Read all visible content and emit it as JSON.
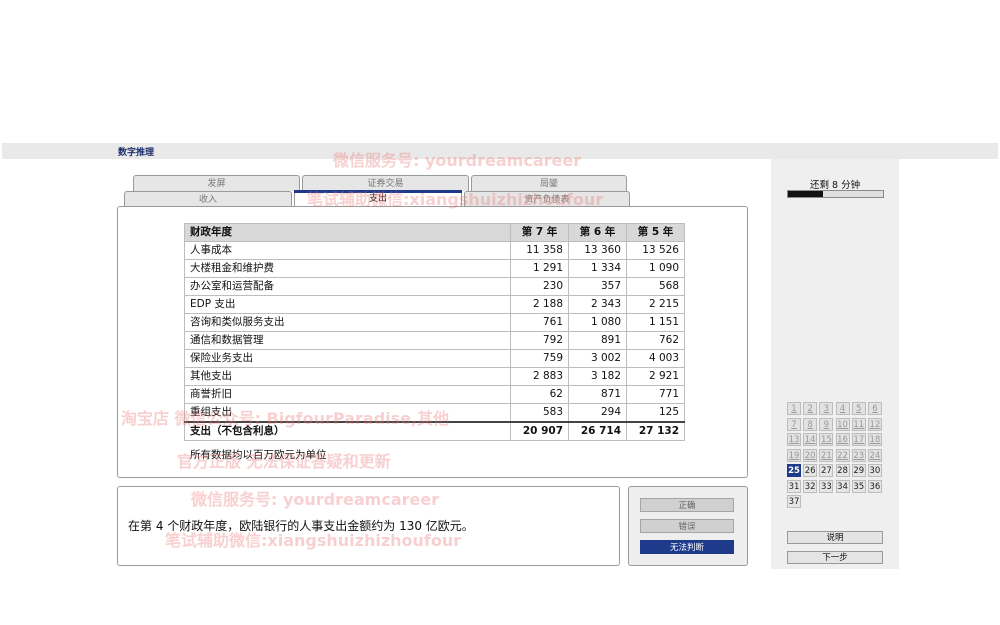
{
  "app": {
    "title": "数字推理"
  },
  "tabs_back": [
    "发屏",
    "证券交易",
    "局鑾"
  ],
  "tabs_front": [
    "收入",
    "支出",
    "资产负债表"
  ],
  "active_tab": "支出",
  "table": {
    "headers": [
      "财政年度",
      "第 7 年",
      "第 6 年",
      "第 5 年"
    ],
    "rows": [
      [
        "人事成本",
        "11 358",
        "13 360",
        "13 526"
      ],
      [
        "大楼租金和维护费",
        "1 291",
        "1 334",
        "1 090"
      ],
      [
        "办公室和运营配备",
        "230",
        "357",
        "568"
      ],
      [
        "EDP 支出",
        "2 188",
        "2 343",
        "2 215"
      ],
      [
        "咨询和类似服务支出",
        "761",
        "1 080",
        "1 151"
      ],
      [
        "通信和数据管理",
        "792",
        "891",
        "762"
      ],
      [
        "保险业务支出",
        "759",
        "3 002",
        "4 003"
      ],
      [
        "其他支出",
        "2 883",
        "3 182",
        "2 921"
      ],
      [
        "商誉折旧",
        "62",
        "871",
        "771"
      ],
      [
        "重组支出",
        "583",
        "294",
        "125"
      ]
    ],
    "total": [
      "支出（不包含利息）",
      "20 907",
      "26 714",
      "27 132"
    ],
    "footnote": "所有数据均以百万欧元为单位"
  },
  "statement": "在第 4 个财政年度，欧陆银行的人事支出金额约为 130 亿欧元。",
  "answers": {
    "options": [
      "正确",
      "错误",
      "无法判断"
    ],
    "selected_index": 2
  },
  "timer": {
    "label": "还剩 8 分钟",
    "remaining_fraction": 0.37
  },
  "question_nav": {
    "numbers": [
      "1",
      "2",
      "3",
      "4",
      "5",
      "6",
      "7",
      "8",
      "9",
      "10",
      "11",
      "12",
      "13",
      "14",
      "15",
      "16",
      "17",
      "18",
      "19",
      "20",
      "21",
      "22",
      "23",
      "24",
      "25",
      "26",
      "27",
      "28",
      "29",
      "30",
      "31",
      "32",
      "33",
      "34",
      "35",
      "36",
      "37"
    ],
    "current": 25,
    "answered_through": 24
  },
  "sidebar_buttons": {
    "help": "说明",
    "next": "下一步"
  },
  "watermarks": [
    "微信服务号: yourdreamcareer",
    "笔试辅助微信:xiangshuizhizhoufour",
    "淘宝店  微信公众号: BigfourParadise,其他",
    "官方正版 无法保证答疑和更新",
    "微信服务号: yourdreamcareer",
    "笔试辅助微信:xiangshuizhizhoufour"
  ],
  "colors": {
    "accent": "#1d3b8a",
    "title": "#1f2f6d",
    "watermark": "#eb7878"
  }
}
